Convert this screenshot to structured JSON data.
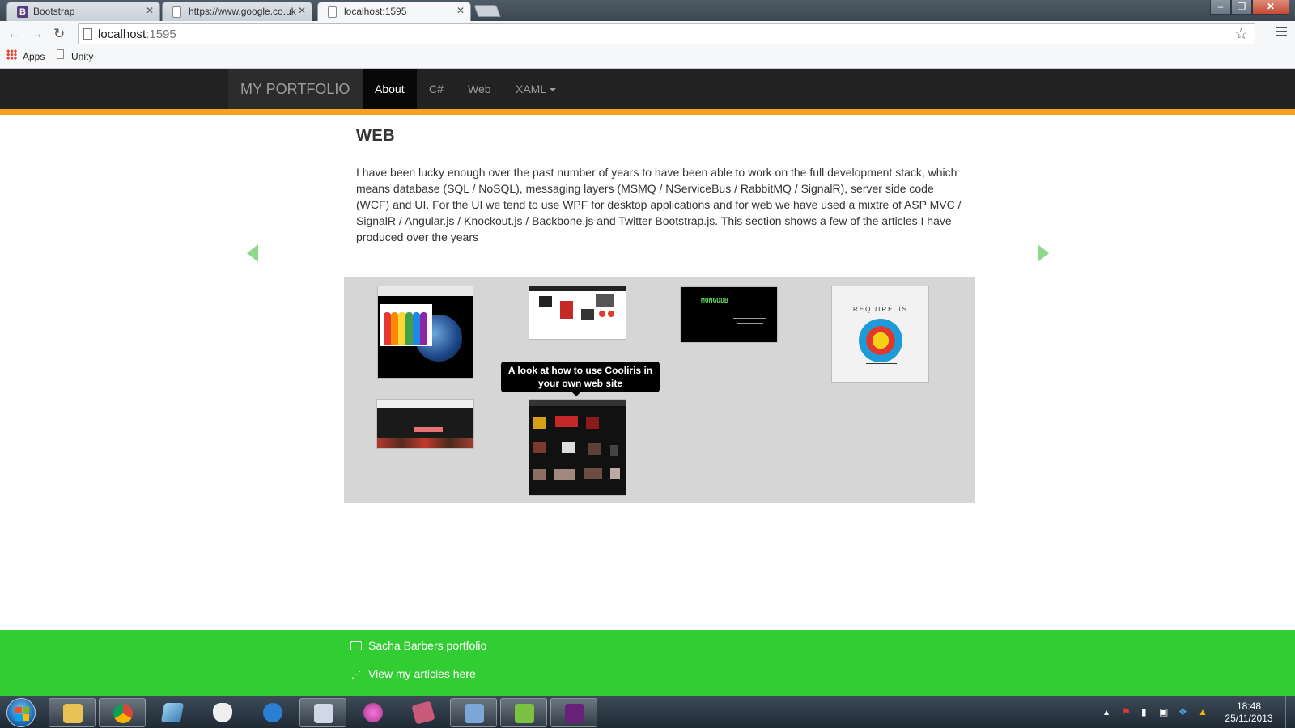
{
  "browser": {
    "tabs": [
      {
        "title": "Bootstrap",
        "favicon": "bootstrap-icon",
        "active": false
      },
      {
        "title": "https://www.google.co.uk",
        "favicon": "page-icon",
        "active": false
      },
      {
        "title": "localhost:1595",
        "favicon": "page-icon",
        "active": true
      }
    ],
    "address": {
      "host": "localhost",
      "port": ":1595"
    },
    "bookmarks": [
      {
        "label": "Apps",
        "icon": "apps-grid-icon"
      },
      {
        "label": "Unity",
        "icon": "page-icon"
      }
    ]
  },
  "navbar": {
    "brand": "MY PORTFOLIO",
    "items": [
      {
        "label": "About",
        "active": true
      },
      {
        "label": "C#",
        "active": false
      },
      {
        "label": "Web",
        "active": false
      },
      {
        "label": "XAML",
        "active": false,
        "dropdown": true
      }
    ],
    "accent_color": "#f5a31e"
  },
  "section": {
    "title": "WEB",
    "text": "I have been lucky enough over the past number of years to have been able to work on the full development stack, which means database (SQL / NoSQL), messaging layers (MSMQ / NServiceBus / RabbitMQ / SignalR), server side code (WCF) and UI. For the UI we tend to use WPF for desktop applications and for web we have used a mixtre of ASP MVC / SignalR / Angular.js / Knockout.js / Backbone.js and Twitter Bootstrap.js. This section shows a few of the articles I have produced over the years"
  },
  "gallery": {
    "tooltip": "A look at how to use Cooliris in your own web site",
    "thumb_texts": {
      "mongo": "MONGODB",
      "requirejs": "REQUIRE.JS"
    }
  },
  "footer": {
    "items": [
      {
        "label": "Sacha Barbers portfolio",
        "icon": "chat-icon"
      },
      {
        "label": "View my articles here",
        "icon": "share-icon"
      }
    ],
    "color": "#32cd32"
  },
  "taskbar": {
    "time": "18:48",
    "date": "25/11/2013"
  }
}
